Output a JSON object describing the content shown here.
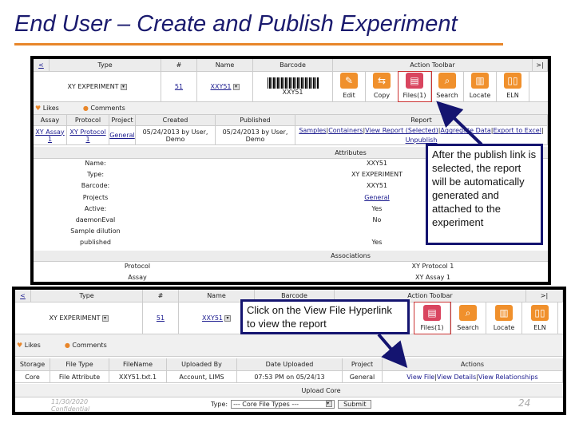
{
  "title": "End User – Create and Publish Experiment",
  "shot1": {
    "header": {
      "back": "<",
      "type": "Type",
      "num": "#",
      "name": "Name",
      "barcode": "Barcode",
      "toolbar": "Action Toolbar",
      "end": ">|"
    },
    "record": {
      "type": "XY EXPERIMENT",
      "num": "51",
      "name": "XXY51",
      "barcode_text": "XXY51"
    },
    "tools": [
      {
        "label": "Edit",
        "icon": "✎"
      },
      {
        "label": "Copy",
        "icon": "⇆"
      },
      {
        "label": "Files(1)",
        "icon": "▤"
      },
      {
        "label": "Search",
        "icon": "⌕"
      },
      {
        "label": "Locate",
        "icon": "▥"
      },
      {
        "label": "ELN",
        "icon": "▯▯"
      }
    ],
    "likes": "Likes",
    "comments": "Comments",
    "cols": [
      "Assay",
      "Protocol",
      "Project",
      "Created",
      "Published",
      "Report"
    ],
    "row": {
      "assay": "XY Assay 1",
      "protocol": "XY Protocol 1",
      "project": "General",
      "created": "05/24/2013 by User, Demo",
      "published": "05/24/2013 by User, Demo",
      "report_links": [
        "Samples",
        "Containers",
        "View Report (Selected)",
        "Aggregate Data",
        "Export to Excel",
        "Unpublish"
      ]
    },
    "attributes_title": "Attributes",
    "attributes": [
      {
        "k": "Name:",
        "v": "XXY51"
      },
      {
        "k": "Type:",
        "v": "XY EXPERIMENT"
      },
      {
        "k": "Barcode:",
        "v": "XXY51"
      },
      {
        "k": "Projects",
        "v": "General"
      },
      {
        "k": "Active:",
        "v": "Yes"
      },
      {
        "k": "daemonEval",
        "v": "No"
      },
      {
        "k": "Sample dilution",
        "v": ""
      },
      {
        "k": "published",
        "v": "Yes"
      }
    ],
    "associations_title": "Associations",
    "associations": [
      {
        "k": "Protocol",
        "v": "XY Protocol 1"
      },
      {
        "k": "Assay",
        "v": "XY Assay 1"
      }
    ]
  },
  "shot2": {
    "header": {
      "back": "<",
      "type": "Type",
      "num": "#",
      "name": "Name",
      "barcode": "Barcode",
      "toolbar": "Action Toolbar",
      "end": ">|"
    },
    "record": {
      "type": "XY EXPERIMENT",
      "num": "51",
      "name": "XXY51"
    },
    "tools": [
      {
        "label": "Files(1)",
        "icon": "▤"
      },
      {
        "label": "Search",
        "icon": "⌕"
      },
      {
        "label": "Locate",
        "icon": "▥"
      },
      {
        "label": "ELN",
        "icon": "▯▯"
      }
    ],
    "likes": "Likes",
    "comments": "Comments",
    "cols": [
      "Storage",
      "File Type",
      "FileName",
      "Uploaded By",
      "Date Uploaded",
      "Project",
      "Actions"
    ],
    "row": {
      "storage": "Core",
      "filetype": "File Attribute",
      "filename": "XXY51.txt.1",
      "uploaded_by": "Account, LIMS",
      "date": "07:53 PM on 05/24/13",
      "project": "General",
      "actions": [
        "View File",
        "View Details",
        "View Relationships"
      ]
    },
    "upload_title": "Upload Core",
    "type_label": "Type:",
    "type_select": "--- Core File Types ---",
    "submit": "Submit"
  },
  "callout1": "After the publish link is selected, the report will be automatically generated and attached to the experiment",
  "callout2": "Click on the View File Hyperlink to view the report",
  "footer": {
    "date": "11/30/2020",
    "confidential": "Confidential",
    "page": "24"
  }
}
